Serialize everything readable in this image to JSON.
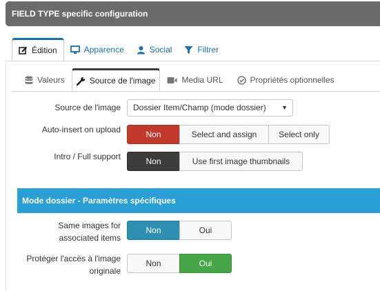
{
  "header": {
    "title": "FIELD TYPE specific configuration"
  },
  "top_tabs": [
    {
      "label": "Édition",
      "icon": "edit-icon",
      "active": true
    },
    {
      "label": "Apparence",
      "icon": "monitor-icon",
      "active": false
    },
    {
      "label": "Social",
      "icon": "user-icon",
      "active": false
    },
    {
      "label": "Filtrer",
      "icon": "filter-icon",
      "active": false
    }
  ],
  "sub_tabs": [
    {
      "label": "Valeurs",
      "icon": "database-icon",
      "active": false
    },
    {
      "label": "Source de l'image",
      "icon": "wrench-icon",
      "active": true
    },
    {
      "label": "Media URL",
      "icon": "video-icon",
      "active": false
    },
    {
      "label": "Propriétés optionnelles",
      "icon": "check-circle-icon",
      "active": false
    }
  ],
  "fields": {
    "source": {
      "label": "Source de l'image",
      "value": "Dossier Item/Champ (mode dossier)"
    },
    "auto_insert": {
      "label": "Auto-insert on upload",
      "options": [
        "Non",
        "Select and assign",
        "Select only"
      ],
      "selected": "Non"
    },
    "intro_full": {
      "label": "Intro / Full support",
      "options": [
        "Non",
        "Use first image thumbnails"
      ],
      "selected": "Non"
    }
  },
  "section": {
    "title": "Mode dossier - Paramètres spécifiques"
  },
  "dossier_fields": {
    "same_images": {
      "label_line1": "Same images for",
      "label_line2": "associated items",
      "options": [
        "Non",
        "Oui"
      ],
      "selected": "Non"
    },
    "protect_access": {
      "label_line1": "Protéger l'accès à l'image",
      "label_line2": "originale",
      "options": [
        "Non",
        "Oui"
      ],
      "selected": "Oui"
    }
  },
  "colors": {
    "header_bg": "#6b6b6b",
    "link_blue": "#1a6fb0",
    "danger": "#c0392b",
    "dark": "#3c3c3c",
    "info": "#2e8fb0",
    "success": "#46a546",
    "section_bg": "#2a9fd6"
  }
}
